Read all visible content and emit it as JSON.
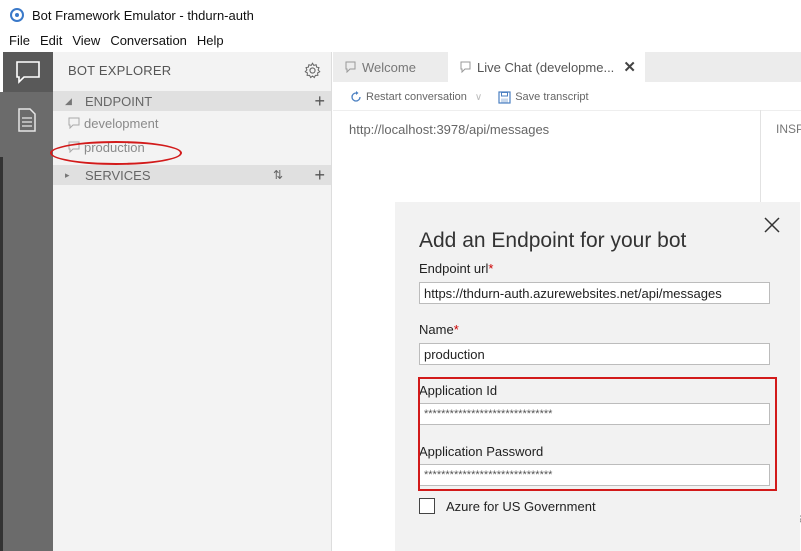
{
  "window": {
    "title": "Bot Framework Emulator - thdurn-auth"
  },
  "menu": [
    "File",
    "Edit",
    "View",
    "Conversation",
    "Help"
  ],
  "activity_bar": {
    "items": [
      "chat-icon",
      "document-icon"
    ]
  },
  "sidebar": {
    "title": "BOT EXPLORER",
    "endpoint_section": "ENDPOINT",
    "endpoints": [
      "development",
      "production"
    ],
    "services_section": "SERVICES"
  },
  "tabs": [
    {
      "label": "Welcome"
    },
    {
      "label": "Live Chat (developme..."
    }
  ],
  "toolbar": {
    "restart_label": "Restart conversation",
    "save_label": "Save transcript"
  },
  "chat": {
    "url": "http://localhost:3978/api/messages",
    "inspector_label": "INSP"
  },
  "dialog": {
    "title": "Add an Endpoint for your bot",
    "endpoint_url_label": "Endpoint url",
    "endpoint_url_value": "https://thdurn-auth.azurewebsites.net/api/messages",
    "name_label": "Name",
    "name_value": "production",
    "app_id_label": "Application Id",
    "app_id_value": "******************************",
    "app_password_label": "Application Password",
    "app_password_value": "******************************",
    "gov_checkbox_label": "Azure for US Government",
    "gov_checkbox_checked": false
  },
  "edge_glyph": "G",
  "colors": {
    "annotation_red": "#d21a1a",
    "activity_bar": "#6b6b6b",
    "sidebar_bg": "#f3f3f3"
  }
}
